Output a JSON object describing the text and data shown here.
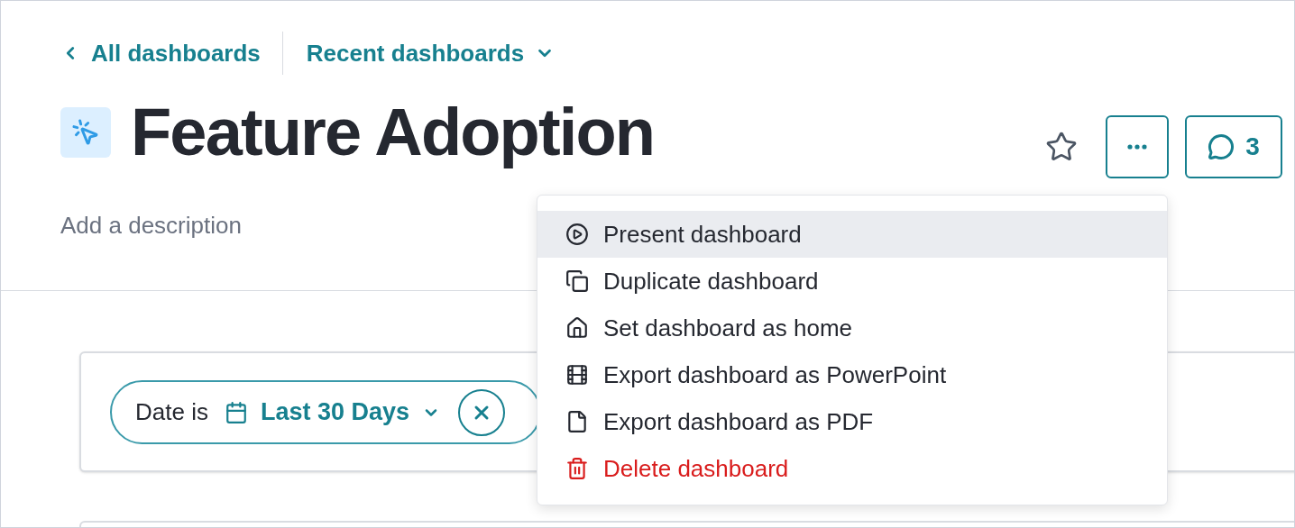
{
  "breadcrumb": {
    "back": "All dashboards",
    "recent": "Recent dashboards"
  },
  "title": "Feature Adoption",
  "description": {
    "placeholder": "Add a description"
  },
  "actions": {
    "starred": false,
    "comments": "3"
  },
  "menu": [
    {
      "label": "Present dashboard",
      "kind": "normal",
      "selected": true
    },
    {
      "label": "Duplicate dashboard",
      "kind": "normal",
      "selected": false
    },
    {
      "label": "Set dashboard as home",
      "kind": "normal",
      "selected": false
    },
    {
      "label": "Export dashboard as PowerPoint",
      "kind": "normal",
      "selected": false
    },
    {
      "label": "Export dashboard as PDF",
      "kind": "normal",
      "selected": false
    },
    {
      "label": "Delete dashboard",
      "kind": "danger",
      "selected": false
    }
  ],
  "filter": {
    "label": "Date is",
    "value": "Last 30 Days"
  }
}
